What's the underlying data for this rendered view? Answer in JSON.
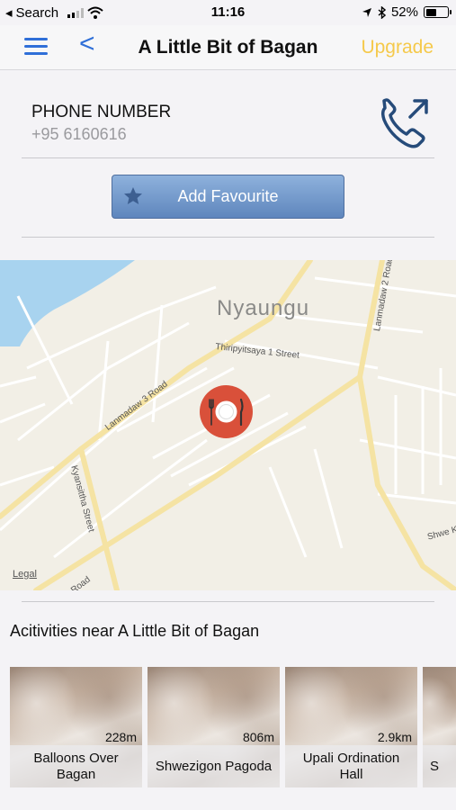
{
  "status_bar": {
    "back_app": "Search",
    "time": "11:16",
    "battery": "52%",
    "battery_level": 0.52
  },
  "nav": {
    "title": "A Little Bit of Bagan",
    "back_glyph": "<",
    "upgrade": "Upgrade"
  },
  "phone": {
    "label": "PHONE NUMBER",
    "value": "+95 6160616"
  },
  "favourite": {
    "label": "Add Favourite"
  },
  "map": {
    "city": "Nyaungu",
    "streets": [
      "Lanmadaw 2 Road",
      "Thiripyitsaya 1 Street",
      "Lanmadaw 3 Road",
      "Kyansittha Street",
      "Shwe K",
      "Road"
    ],
    "legal": "Legal"
  },
  "activities": {
    "title": "Acitivities near A Little Bit of Bagan",
    "items": [
      {
        "name": "Balloons Over Bagan",
        "distance": "228m"
      },
      {
        "name": "Shwezigon Pagoda",
        "distance": "806m"
      },
      {
        "name": "Upali Ordination Hall",
        "distance": "2.9km"
      },
      {
        "name": "S",
        "distance": ""
      }
    ]
  },
  "colors": {
    "accent": "#2f6fd8",
    "upgrade": "#f5c94a",
    "pin": "#d9503a"
  }
}
